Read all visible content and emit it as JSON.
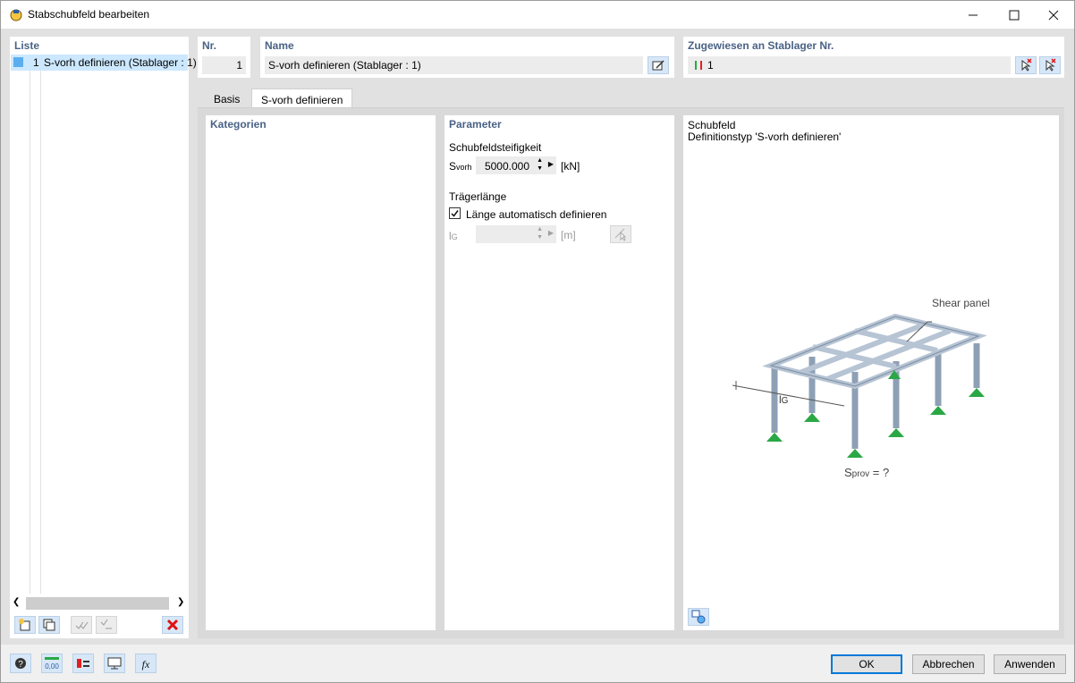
{
  "window": {
    "title": "Stabschubfeld bearbeiten"
  },
  "liste": {
    "title": "Liste",
    "items": [
      {
        "num": "1",
        "label": "S-vorh definieren (Stablager : 1)"
      }
    ]
  },
  "header": {
    "nr_label": "Nr.",
    "nr_value": "1",
    "name_label": "Name",
    "name_value": "S-vorh definieren (Stablager : 1)",
    "assigned_label": "Zugewiesen an Stablager Nr.",
    "assigned_value": "1"
  },
  "tabs": [
    "Basis",
    "S-vorh definieren"
  ],
  "kategorien": {
    "title": "Kategorien"
  },
  "parameter": {
    "title": "Parameter",
    "stiffness_group": "Schubfeldsteifigkeit",
    "s_label_main": "S",
    "s_label_sub": "vorh",
    "s_value": "5000.000",
    "s_unit": "[kN]",
    "length_group": "Trägerlänge",
    "auto_length_label": "Länge automatisch definieren",
    "auto_length_checked": true,
    "lg_label_main": "l",
    "lg_label_sub": "G",
    "lg_value": "",
    "lg_unit": "[m]"
  },
  "preview": {
    "title": "Schubfeld",
    "subtitle": "Definitionstyp 'S-vorh definieren'",
    "shear_panel_label": "Shear panel",
    "lg_main": "l",
    "lg_sub": "G",
    "sprov_main": "S",
    "sprov_sub": "prov",
    "sprov_rest": " = ?"
  },
  "buttons": {
    "ok": "OK",
    "cancel": "Abbrechen",
    "apply": "Anwenden"
  },
  "colors": {
    "accent": "#0078d7",
    "section_title": "#4a6285",
    "support": "#2aa845",
    "selection": "#cce8ff"
  }
}
